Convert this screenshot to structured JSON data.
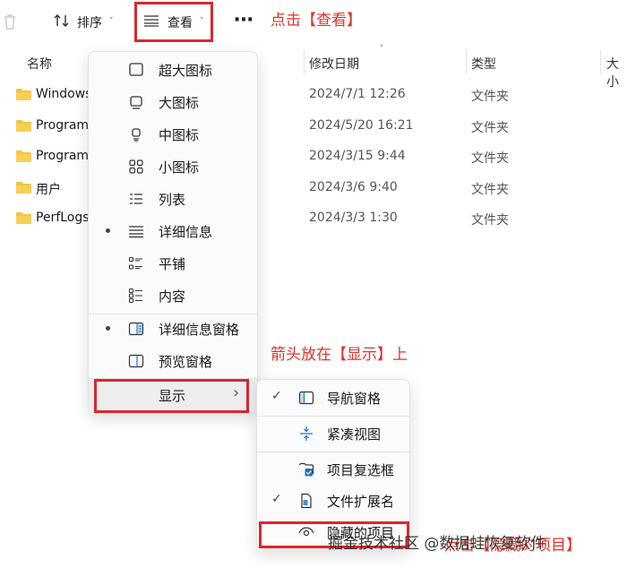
{
  "toolbar": {
    "sort_label": "排序",
    "view_label": "查看",
    "more_label": "⋯"
  },
  "annotations": {
    "click_view": "点击【查看】",
    "hover_show": "箭头放在【显示】上",
    "click_hidden": "点击【隐藏的项目】"
  },
  "columns": {
    "name": "名称",
    "modified": "修改日期",
    "type": "类型",
    "size": "大小"
  },
  "files": [
    {
      "name": "Windows",
      "modified": "2024/7/1 12:26",
      "type": "文件夹"
    },
    {
      "name": "Program",
      "modified": "2024/5/20 16:21",
      "type": "文件夹"
    },
    {
      "name": "Program",
      "modified": "2024/3/15 9:44",
      "type": "文件夹"
    },
    {
      "name": "用户",
      "modified": "2024/3/6 9:40",
      "type": "文件夹"
    },
    {
      "name": "PerfLogs",
      "modified": "2024/3/3 1:30",
      "type": "文件夹"
    }
  ],
  "view_menu": {
    "items": [
      {
        "label": "超大图标",
        "icon": "extra-large-icons-icon",
        "selected": false
      },
      {
        "label": "大图标",
        "icon": "large-icons-icon",
        "selected": false
      },
      {
        "label": "中图标",
        "icon": "medium-icons-icon",
        "selected": false
      },
      {
        "label": "小图标",
        "icon": "small-icons-icon",
        "selected": false
      },
      {
        "label": "列表",
        "icon": "list-icon",
        "selected": false
      },
      {
        "label": "详细信息",
        "icon": "details-icon",
        "selected": true
      },
      {
        "label": "平铺",
        "icon": "tiles-icon",
        "selected": false
      },
      {
        "label": "内容",
        "icon": "content-icon",
        "selected": false
      }
    ],
    "panes": [
      {
        "label": "详细信息窗格",
        "icon": "details-pane-icon",
        "selected": true
      },
      {
        "label": "预览窗格",
        "icon": "preview-pane-icon",
        "selected": false
      }
    ],
    "show_label": "显示",
    "show_arrow": "›"
  },
  "show_menu": {
    "items": [
      {
        "label": "导航窗格",
        "icon": "navigation-pane-icon",
        "checked": true
      },
      {
        "label": "紧凑视图",
        "icon": "compact-view-icon",
        "checked": false
      },
      {
        "label": "项目复选框",
        "icon": "item-checkbox-icon",
        "checked": false
      },
      {
        "label": "文件扩展名",
        "icon": "file-extension-icon",
        "checked": true
      },
      {
        "label": "隐藏的项目",
        "icon": "hidden-items-icon",
        "checked": false
      }
    ],
    "check_mark": "✓"
  },
  "watermark": "掘金技术社区 @数据蛙恢复软件",
  "colors": {
    "accent_red": "#d8282f",
    "folder_yellow": "#f2c340",
    "checkbox_blue": "#1f6fcc"
  }
}
